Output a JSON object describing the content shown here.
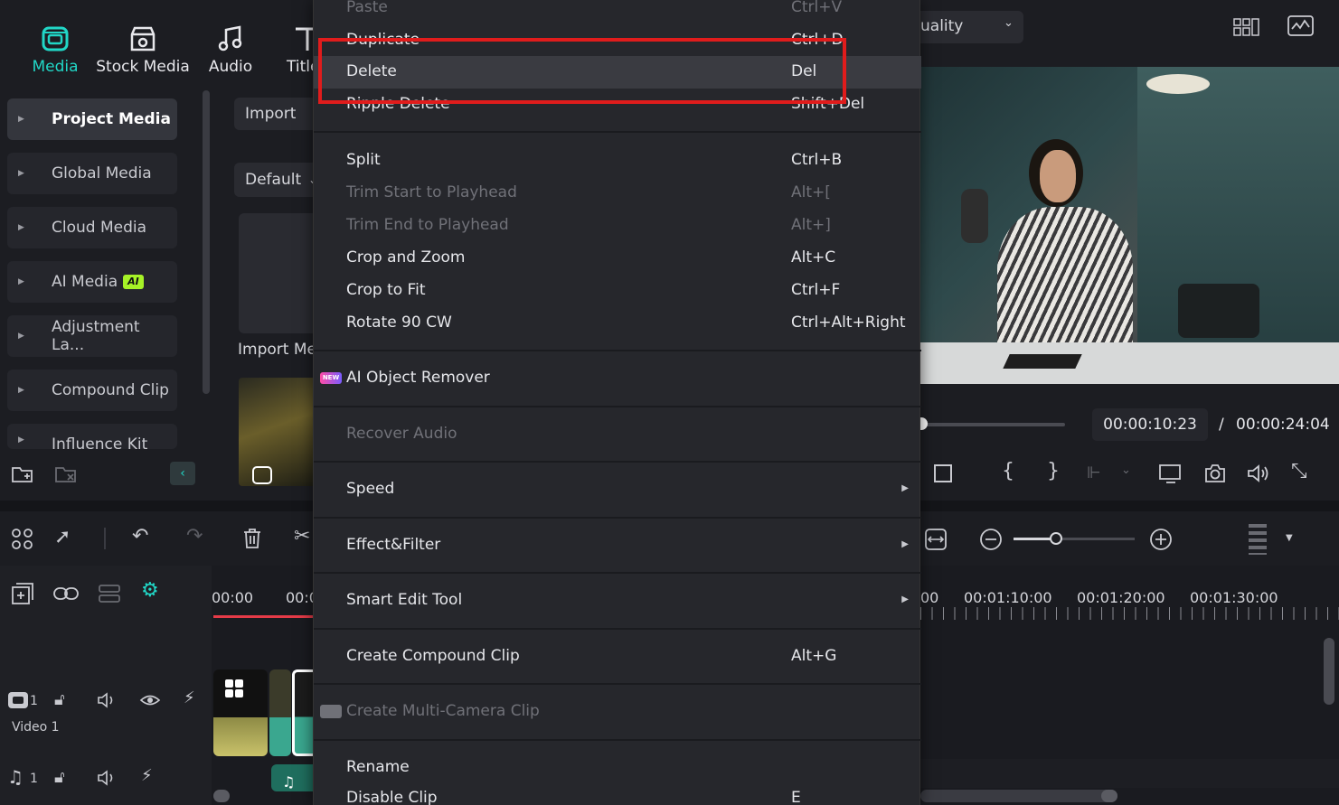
{
  "nav": {
    "tabs": [
      {
        "label": "Media",
        "icon": "media-icon",
        "active": true
      },
      {
        "label": "Stock Media",
        "icon": "stock-media-icon"
      },
      {
        "label": "Audio",
        "icon": "music-note-icon"
      },
      {
        "label": "Title",
        "icon": "title-icon"
      }
    ],
    "accent": "#21d7c7"
  },
  "sidebar": {
    "items": [
      {
        "label": "Project Media",
        "active": true
      },
      {
        "label": "Global Media"
      },
      {
        "label": "Cloud Media"
      },
      {
        "label": "AI Media",
        "badge": "AI"
      },
      {
        "label": "Adjustment La..."
      },
      {
        "label": "Compound Clip"
      },
      {
        "label": "Influence Kit"
      }
    ]
  },
  "media": {
    "import_label": "Import",
    "sort_label": "Default",
    "import_media_label": "Import Me"
  },
  "preview": {
    "quality_label": "uality",
    "current_time": "00:00:10:23",
    "separator": "/",
    "total_time": "00:00:24:04"
  },
  "timeline": {
    "ruler": [
      "00:00",
      "00:0",
      "00",
      "00:01:10:00",
      "00:01:20:00",
      "00:01:30:00"
    ],
    "tracks": [
      {
        "label": "Video 1",
        "index": "1"
      },
      {
        "label": "",
        "index": "1"
      }
    ],
    "zoom_level": 0.35
  },
  "context_menu": {
    "items": [
      {
        "label": "Paste",
        "shortcut": "Ctrl+V",
        "disabled": true
      },
      {
        "label": "Duplicate",
        "shortcut": "Ctrl+D"
      },
      {
        "label": "Delete",
        "shortcut": "Del",
        "highlighted": true
      },
      {
        "label": "Ripple Delete",
        "shortcut": "Shift+Del"
      },
      {
        "label": "Split",
        "shortcut": "Ctrl+B"
      },
      {
        "label": "Trim Start to Playhead",
        "shortcut": "Alt+[",
        "disabled": true
      },
      {
        "label": "Trim End to Playhead",
        "shortcut": "Alt+]",
        "disabled": true
      },
      {
        "label": "Crop and Zoom",
        "shortcut": "Alt+C"
      },
      {
        "label": "Crop to Fit",
        "shortcut": "Ctrl+F"
      },
      {
        "label": "Rotate 90 CW",
        "shortcut": "Ctrl+Alt+Right"
      },
      {
        "label": "AI Object Remover",
        "shortcut": "",
        "badge": "NEW"
      },
      {
        "label": "Recover Audio",
        "shortcut": "",
        "disabled": true
      },
      {
        "label": "Speed",
        "shortcut": "",
        "submenu": true
      },
      {
        "label": "Effect&Filter",
        "shortcut": "",
        "submenu": true
      },
      {
        "label": "Smart Edit Tool",
        "shortcut": "",
        "submenu": true
      },
      {
        "label": "Create Compound Clip",
        "shortcut": "Alt+G"
      },
      {
        "label": "Create Multi-Camera Clip",
        "shortcut": "",
        "disabled": true
      },
      {
        "label": "Rename",
        "shortcut": ""
      },
      {
        "label": "Disable Clip",
        "shortcut": "E"
      }
    ]
  },
  "annotation_color": "#e01c1c"
}
